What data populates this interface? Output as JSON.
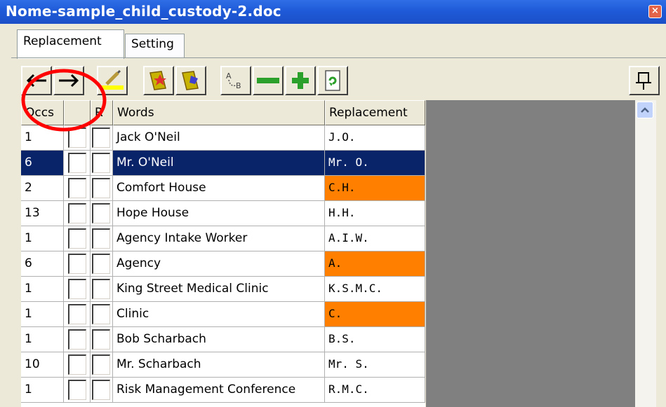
{
  "window": {
    "title": "Nome-sample_child_custody-2.doc",
    "close_icon": "×"
  },
  "tabs": [
    {
      "label": "Replacement",
      "active": true
    },
    {
      "label": "Setting",
      "active": false
    }
  ],
  "toolbar": {
    "buttons": [
      "arrow-left-icon",
      "arrow-right-icon",
      "highlighter-icon",
      "book-star-icon",
      "book-swap-icon",
      "a-to-b-icon",
      "minus-icon",
      "plus-icon",
      "refresh-doc-icon"
    ],
    "pin_icon": "pin-icon"
  },
  "table": {
    "headers": {
      "occs": "Occs",
      "c1": "",
      "r": "R",
      "words": "Words",
      "replacement": "Replacement"
    },
    "rows": [
      {
        "occs": "1",
        "word": "Jack O'Neil",
        "replacement": "J.O.",
        "selected": false,
        "highlight": false
      },
      {
        "occs": "6",
        "word": "Mr. O'Neil",
        "replacement": "Mr. O.",
        "selected": true,
        "highlight": false
      },
      {
        "occs": "2",
        "word": "Comfort House",
        "replacement": "C.H.",
        "selected": false,
        "highlight": true
      },
      {
        "occs": "13",
        "word": "Hope House",
        "replacement": "H.H.",
        "selected": false,
        "highlight": false
      },
      {
        "occs": "1",
        "word": "Agency Intake Worker",
        "replacement": "A.I.W.",
        "selected": false,
        "highlight": false
      },
      {
        "occs": "6",
        "word": "Agency",
        "replacement": "A.",
        "selected": false,
        "highlight": true
      },
      {
        "occs": "1",
        "word": "King Street Medical Clinic",
        "replacement": "K.S.M.C.",
        "selected": false,
        "highlight": false
      },
      {
        "occs": "1",
        "word": "Clinic",
        "replacement": "C.",
        "selected": false,
        "highlight": true
      },
      {
        "occs": "1",
        "word": "Bob Scharbach",
        "replacement": "B.S.",
        "selected": false,
        "highlight": false
      },
      {
        "occs": "10",
        "word": "Mr. Scharbach",
        "replacement": "Mr. S.",
        "selected": false,
        "highlight": false
      },
      {
        "occs": "1",
        "word": "Risk Management Conference",
        "replacement": "R.M.C.",
        "selected": false,
        "highlight": false
      }
    ]
  },
  "colors": {
    "selected_row": "#0a246a",
    "highlight": "#ff8000",
    "titlebar": "#1f5ad8",
    "annotation": "#ff0000"
  }
}
